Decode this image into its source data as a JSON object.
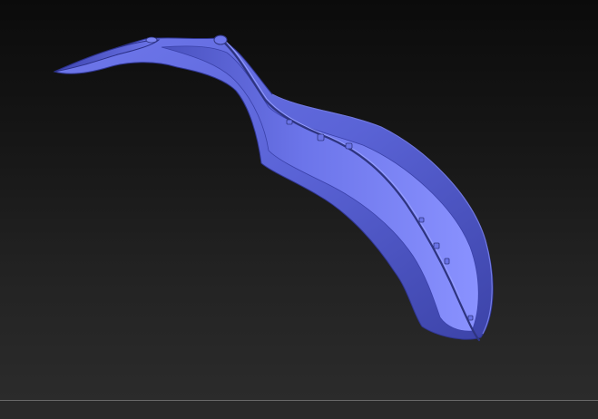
{
  "viewport": {
    "model_icon": "sculpted-curved-blade-model",
    "model_color": "#5a63d6",
    "background_top": "#0b0b0b",
    "background_bottom": "#2b2b2b"
  },
  "status_bar": {
    "text": ""
  }
}
